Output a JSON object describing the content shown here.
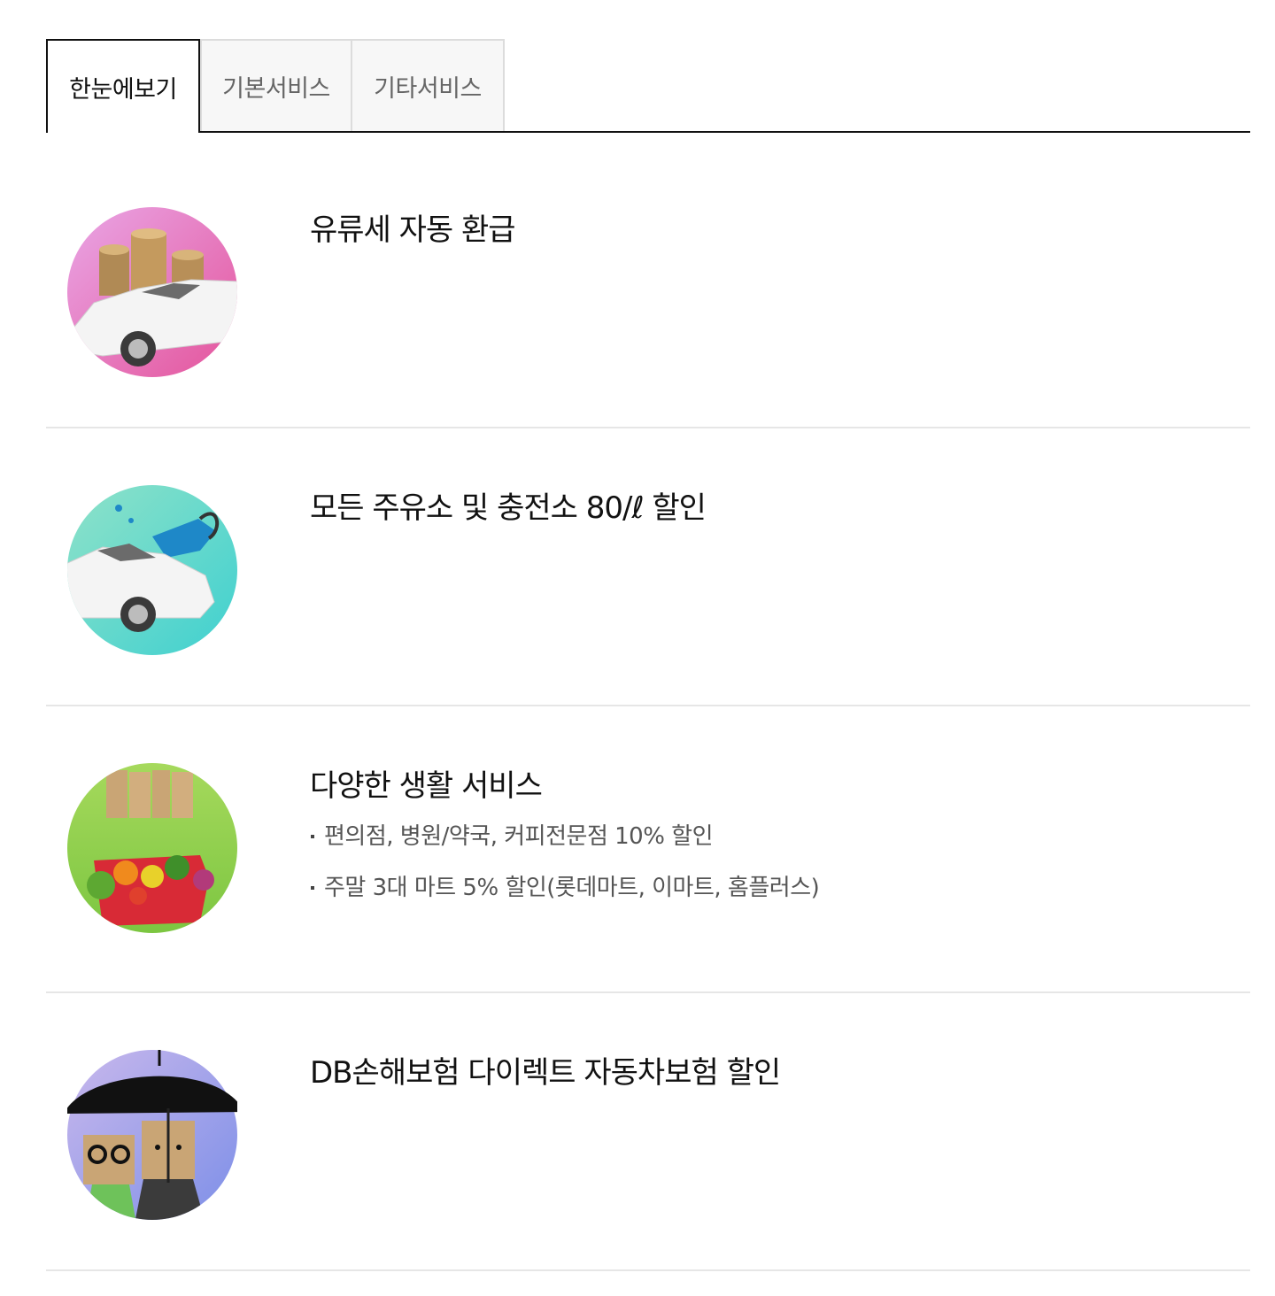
{
  "tabs": [
    {
      "label": "한눈에보기",
      "active": true
    },
    {
      "label": "기본서비스",
      "active": false
    },
    {
      "label": "기타서비스",
      "active": false
    }
  ],
  "items": [
    {
      "title": "유류세 자동 환급",
      "image": "car-with-coins-illustration",
      "bullets": []
    },
    {
      "title": "모든 주유소 및 충전소 80/ℓ 할인",
      "image": "car-fuel-nozzle-illustration",
      "bullets": []
    },
    {
      "title": "다양한 생활 서비스",
      "image": "sale-grocery-basket-illustration",
      "bullets": [
        "편의점, 병원/약국, 커피전문점 10% 할인",
        "주말 3대 마트 5% 할인(롯데마트, 이마트, 홈플러스)"
      ]
    },
    {
      "title": "DB손해보험 다이렉트 자동차보험 할인",
      "image": "umbrella-characters-illustration",
      "bullets": []
    }
  ],
  "colors": {
    "active_tab_border": "#111111",
    "inactive_tab_bg": "#f7f7f7",
    "inactive_tab_text": "#666666",
    "divider": "#e6e6e6"
  }
}
